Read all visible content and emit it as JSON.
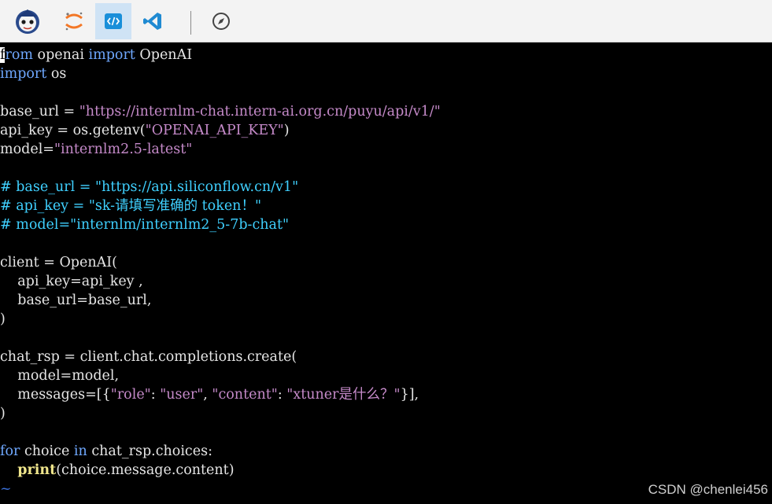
{
  "toolbar": {
    "buttons": [
      {
        "name": "app-logo",
        "icon": "mascot-icon"
      },
      {
        "name": "jupyter",
        "icon": "jupyter-icon"
      },
      {
        "name": "code-editor",
        "icon": "code-icon",
        "active": true
      },
      {
        "name": "vscode",
        "icon": "vscode-icon"
      },
      {
        "name": "browser",
        "icon": "compass-icon"
      }
    ]
  },
  "editor": {
    "lines": [
      {
        "tokens": [
          {
            "t": "f",
            "c": "cursor"
          },
          {
            "t": "rom",
            "c": "kw"
          },
          {
            "t": " openai ",
            "c": ""
          },
          {
            "t": "import",
            "c": "kw"
          },
          {
            "t": " OpenAI",
            "c": ""
          }
        ]
      },
      {
        "tokens": [
          {
            "t": "import",
            "c": "kw"
          },
          {
            "t": " os",
            "c": ""
          }
        ]
      },
      {
        "tokens": []
      },
      {
        "tokens": [
          {
            "t": "base_url = ",
            "c": ""
          },
          {
            "t": "\"https://internlm-chat.intern-ai.org.cn/puyu/api/v1/\"",
            "c": "str"
          }
        ]
      },
      {
        "tokens": [
          {
            "t": "api_key = os.getenv(",
            "c": ""
          },
          {
            "t": "\"OPENAI_API_KEY\"",
            "c": "str"
          },
          {
            "t": ")",
            "c": ""
          }
        ]
      },
      {
        "tokens": [
          {
            "t": "model=",
            "c": ""
          },
          {
            "t": "\"internlm2.5-latest\"",
            "c": "str"
          }
        ]
      },
      {
        "tokens": []
      },
      {
        "tokens": [
          {
            "t": "# base_url = \"https://api.siliconflow.cn/v1\"",
            "c": "cm"
          }
        ]
      },
      {
        "tokens": [
          {
            "t": "# api_key = \"sk-请填写准确的 token！\"",
            "c": "cm"
          }
        ]
      },
      {
        "tokens": [
          {
            "t": "# model=\"internlm/internlm2_5-7b-chat\"",
            "c": "cm"
          }
        ]
      },
      {
        "tokens": []
      },
      {
        "tokens": [
          {
            "t": "client = OpenAI(",
            "c": ""
          }
        ]
      },
      {
        "tokens": [
          {
            "t": "    api_key=api_key ,",
            "c": ""
          }
        ]
      },
      {
        "tokens": [
          {
            "t": "    base_url=base_url,",
            "c": ""
          }
        ]
      },
      {
        "tokens": [
          {
            "t": ")",
            "c": ""
          }
        ]
      },
      {
        "tokens": []
      },
      {
        "tokens": [
          {
            "t": "chat_rsp = client.chat.completions.create(",
            "c": ""
          }
        ]
      },
      {
        "tokens": [
          {
            "t": "    model=model,",
            "c": ""
          }
        ]
      },
      {
        "tokens": [
          {
            "t": "    messages=[{",
            "c": ""
          },
          {
            "t": "\"role\"",
            "c": "str"
          },
          {
            "t": ": ",
            "c": ""
          },
          {
            "t": "\"user\"",
            "c": "str"
          },
          {
            "t": ", ",
            "c": ""
          },
          {
            "t": "\"content\"",
            "c": "str"
          },
          {
            "t": ": ",
            "c": ""
          },
          {
            "t": "\"xtuner是什么？\"",
            "c": "str"
          },
          {
            "t": "}],",
            "c": ""
          }
        ]
      },
      {
        "tokens": [
          {
            "t": ")",
            "c": ""
          }
        ]
      },
      {
        "tokens": []
      },
      {
        "tokens": [
          {
            "t": "for",
            "c": "kw"
          },
          {
            "t": " choice ",
            "c": ""
          },
          {
            "t": "in",
            "c": "kw"
          },
          {
            "t": " chat_rsp.choices:",
            "c": ""
          }
        ]
      },
      {
        "tokens": [
          {
            "t": "    ",
            "c": ""
          },
          {
            "t": "print",
            "c": "bi"
          },
          {
            "t": "(choice.message.content)",
            "c": ""
          }
        ]
      },
      {
        "tokens": [
          {
            "t": "~",
            "c": "tilde"
          }
        ]
      },
      {
        "tokens": [
          {
            "t": "~",
            "c": "tilde"
          }
        ]
      }
    ]
  },
  "watermark": "CSDN @chenlei456",
  "colors": {
    "keyword": "#6fa8ff",
    "string": "#c58ac9",
    "comment": "#3fd0ff",
    "active_tool_bg": "#cfe3f5"
  }
}
